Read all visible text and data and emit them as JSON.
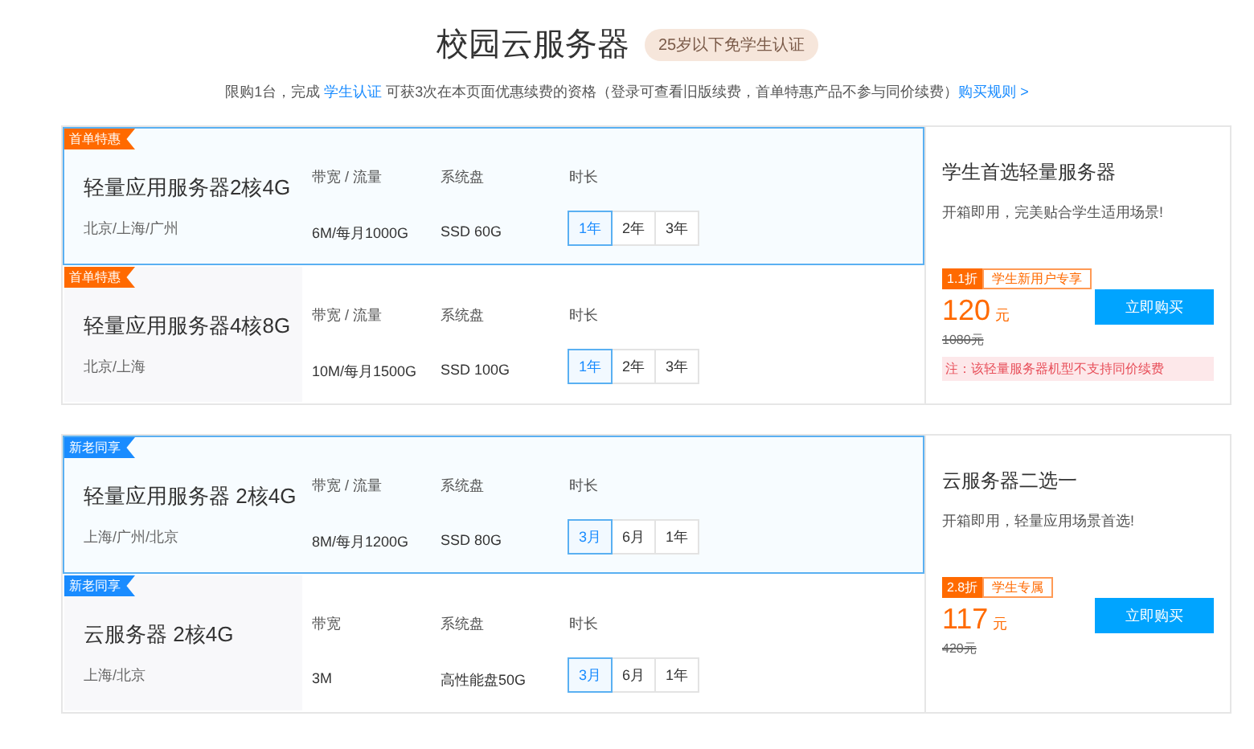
{
  "header": {
    "title": "校园云服务器",
    "badge": "25岁以下免学生认证",
    "notice_parts": [
      {
        "kind": "text",
        "text": "限购1台，完成 "
      },
      {
        "kind": "link",
        "text": "学生认证"
      },
      {
        "kind": "text",
        "text": " 可获3次在本页面优惠续费的资格（登录可查看旧版续费，首单特惠产品不参与同价续费）"
      },
      {
        "kind": "link",
        "text": "购买规则 >"
      }
    ]
  },
  "groups": [
    {
      "products": [
        {
          "tag": "首单特惠",
          "color": "#ff6a00",
          "selected": true,
          "name": "轻量应用服务器2核4G",
          "regions": "北京/上海/广州",
          "specs": [
            {
              "label": "带宽 / 流量",
              "value": "6M/每月1000G"
            },
            {
              "label": "系统盘",
              "value": "SSD 60G"
            }
          ],
          "duration_label": "时长",
          "durations": [
            {
              "label": "1年",
              "selected": true
            },
            {
              "label": "2年",
              "selected": false
            },
            {
              "label": "3年",
              "selected": false
            }
          ]
        },
        {
          "tag": "首单特惠",
          "color": "#ff6a00",
          "selected": false,
          "name": "轻量应用服务器4核8G",
          "regions": "北京/上海",
          "specs": [
            {
              "label": "带宽 / 流量",
              "value": "10M/每月1500G"
            },
            {
              "label": "系统盘",
              "value": "SSD 100G"
            }
          ],
          "duration_label": "时长",
          "durations": [
            {
              "label": "1年",
              "selected": true
            },
            {
              "label": "2年",
              "selected": false
            },
            {
              "label": "3年",
              "selected": false
            }
          ]
        }
      ],
      "offer": {
        "title": "学生首选轻量服务器",
        "subtitle": "开箱即用，完美贴合学生适用场景!",
        "discount": "1.1折",
        "discount_label": "学生新用户专享",
        "price": "120",
        "unit": "元",
        "old_price": "1080元",
        "button": "立即购买",
        "note": "注：该轻量服务器机型不支持同价续费"
      }
    },
    {
      "products": [
        {
          "tag": "新老同享",
          "color": "#1a8cff",
          "selected": true,
          "name": "轻量应用服务器 2核4G",
          "regions": "上海/广州/北京",
          "specs": [
            {
              "label": "带宽 / 流量",
              "value": "8M/每月1200G"
            },
            {
              "label": "系统盘",
              "value": "SSD 80G"
            }
          ],
          "duration_label": "时长",
          "durations": [
            {
              "label": "3月",
              "selected": true
            },
            {
              "label": "6月",
              "selected": false
            },
            {
              "label": "1年",
              "selected": false
            }
          ]
        },
        {
          "tag": "新老同享",
          "color": "#1a8cff",
          "selected": false,
          "name": "云服务器 2核4G",
          "regions": "上海/北京",
          "specs": [
            {
              "label": "带宽",
              "value": "3M"
            },
            {
              "label": "系统盘",
              "value": "高性能盘50G"
            }
          ],
          "duration_label": "时长",
          "durations": [
            {
              "label": "3月",
              "selected": true
            },
            {
              "label": "6月",
              "selected": false
            },
            {
              "label": "1年",
              "selected": false
            }
          ]
        }
      ],
      "offer": {
        "title": "云服务器二选一",
        "subtitle": "开箱即用，轻量应用场景首选!",
        "discount": "2.8折",
        "discount_label": "学生专属",
        "price": "117",
        "unit": "元",
        "old_price": "420元",
        "button": "立即购买"
      }
    }
  ]
}
